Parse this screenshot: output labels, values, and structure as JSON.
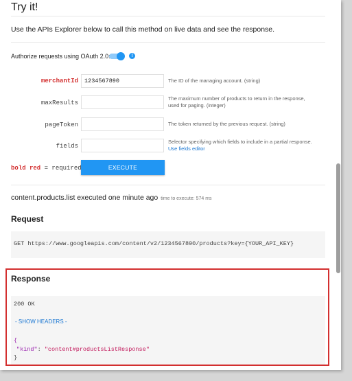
{
  "title": "Try it!",
  "description": "Use the APIs Explorer below to call this method on live data and see the response.",
  "oauth": {
    "label": "Authorize requests using OAuth 2.0:",
    "info_glyph": "!",
    "accent_color": "#2196f3"
  },
  "params": [
    {
      "name": "merchantId",
      "value": "1234567890",
      "required": true,
      "desc_lines": [
        "The ID of the managing account. (string)"
      ],
      "link": ""
    },
    {
      "name": "maxResults",
      "value": "",
      "required": false,
      "desc_lines": [
        "The maximum number of products to return in the response,",
        "used for paging. (integer)"
      ],
      "link": ""
    },
    {
      "name": "pageToken",
      "value": "",
      "required": false,
      "desc_lines": [
        "The token returned by the previous request. (string)"
      ],
      "link": ""
    },
    {
      "name": "fields",
      "value": "",
      "required": false,
      "desc_lines": [
        "Selector specifying which fields to include in a partial response."
      ],
      "link": "Use fields editor"
    }
  ],
  "required_note": {
    "red": "bold red",
    "rest": " = required"
  },
  "execute_label": "EXECUTE",
  "executed": {
    "text": "content.products.list executed one minute ago",
    "time": "time to execute: 574 ms"
  },
  "request": {
    "heading": "Request",
    "line": "GET https://www.googleapis.com/content/v2/1234567890/products?key={YOUR_API_KEY}"
  },
  "response": {
    "heading": "Response",
    "status": "200 OK",
    "show_headers": "- SHOW HEADERS -",
    "open_brace": "{",
    "key": "\"kind\"",
    "sep": ": ",
    "value": "\"content#productsListResponse\"",
    "close_brace": "}"
  }
}
